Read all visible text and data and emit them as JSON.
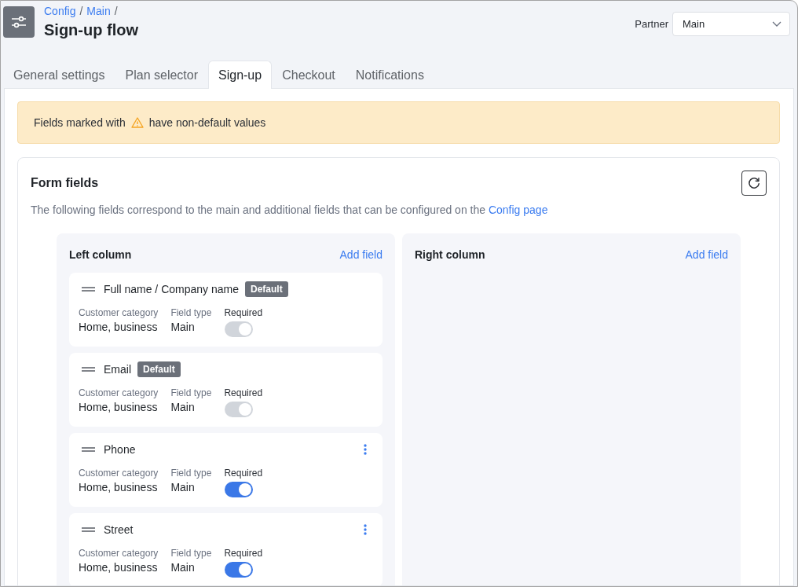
{
  "header": {
    "breadcrumbs": [
      {
        "label": "Config",
        "separator": "/"
      },
      {
        "label": "Main",
        "separator": "/"
      }
    ],
    "title": "Sign-up flow",
    "partner": {
      "label": "Partner",
      "value": "Main"
    }
  },
  "tabs": [
    {
      "label": "General settings",
      "selected": false
    },
    {
      "label": "Plan selector",
      "selected": false
    },
    {
      "label": "Sign-up",
      "selected": true
    },
    {
      "label": "Checkout",
      "selected": false
    },
    {
      "label": "Notifications",
      "selected": false
    }
  ],
  "alert": {
    "text_before_icon": "Fields marked with",
    "text_after_icon": "have non-default values"
  },
  "form_fields": {
    "title": "Form fields",
    "description": "The following fields correspond to the main and additional fields that can be configured on the",
    "link": "Config page",
    "columns": [
      {
        "title": "Left column",
        "action": "Add field",
        "fields": [
          {
            "name": "Full name / Company name",
            "badge": "Default",
            "menu": false,
            "category_label": "Customer category",
            "category": "Home, business",
            "type_label": "Field type",
            "type": "Main",
            "required_label": "Required",
            "required": true,
            "disabled": true
          },
          {
            "name": "Email",
            "badge": "Default",
            "menu": false,
            "category_label": "Customer category",
            "category": "Home, business",
            "type_label": "Field type",
            "type": "Main",
            "required_label": "Required",
            "required": true,
            "disabled": true
          },
          {
            "name": "Phone",
            "menu": true,
            "category_label": "Customer category",
            "category": "Home, business",
            "type_label": "Field type",
            "type": "Main",
            "required_label": "Required",
            "required": true,
            "disabled": false
          },
          {
            "name": "Street",
            "menu": true,
            "category_label": "Customer category",
            "category": "Home, business",
            "type_label": "Field type",
            "type": "Main",
            "required_label": "Required",
            "required": true,
            "disabled": false
          }
        ]
      },
      {
        "title": "Right column",
        "action": "Add field"
      }
    ]
  }
}
